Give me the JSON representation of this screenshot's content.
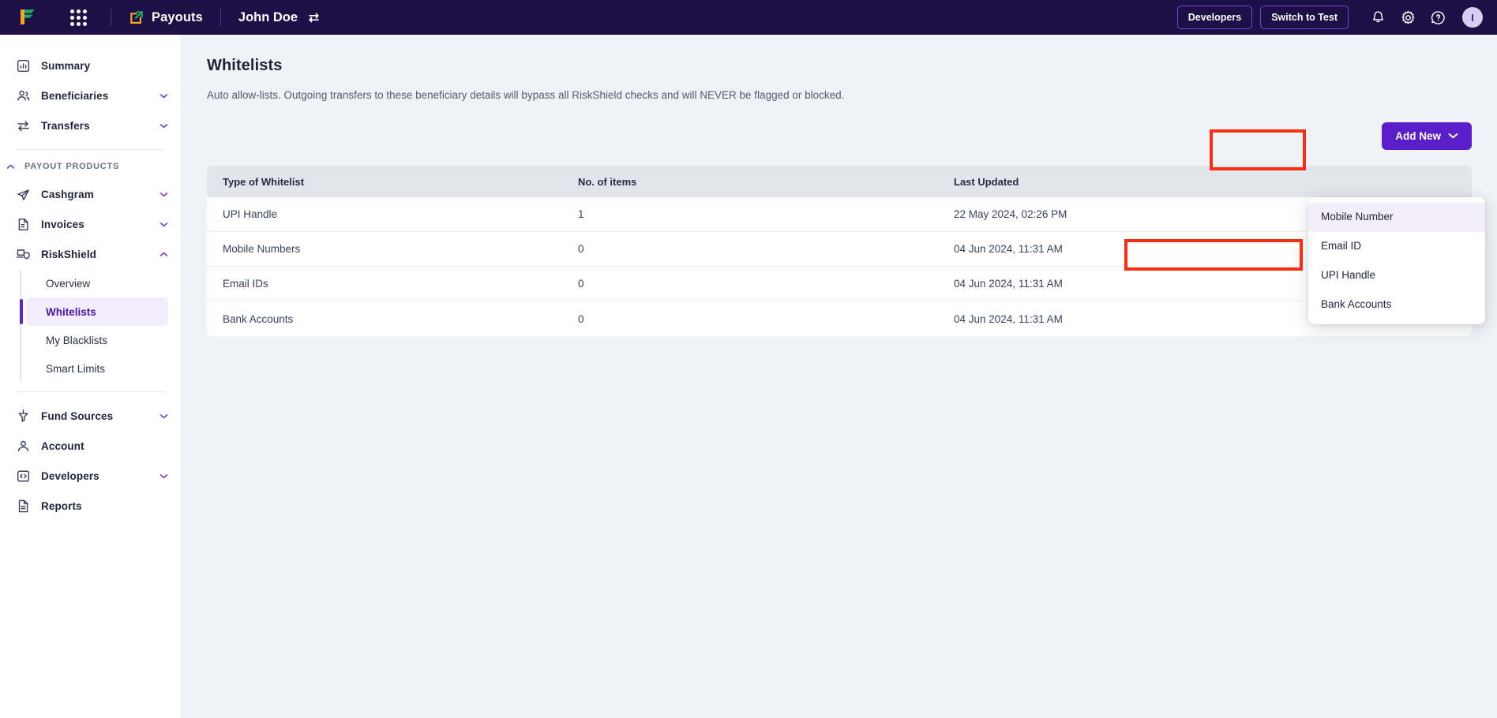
{
  "topbar": {
    "logo_name": "cashfree-logo",
    "apps_grid_name": "app-switcher-grid",
    "product_label": "Payouts",
    "account_name": "John Doe",
    "switch_account_icon": "swap-icon",
    "developers_label": "Developers",
    "switch_to_test_label": "Switch to Test",
    "notification_icon": "bell-icon",
    "settings_icon": "gear-icon",
    "help_icon": "help-circle-icon",
    "avatar_initial": "I"
  },
  "sidebar": {
    "top_items": [
      {
        "label": "Summary",
        "icon": "chart-bar-icon",
        "chevron": false
      },
      {
        "label": "Beneficiaries",
        "icon": "users-icon",
        "chevron": true
      },
      {
        "label": "Transfers",
        "icon": "transfer-icon",
        "chevron": true
      }
    ],
    "section_label": "PAYOUT PRODUCTS",
    "product_items": [
      {
        "label": "Cashgram",
        "icon": "send-icon",
        "chevron": true,
        "expanded": false
      },
      {
        "label": "Invoices",
        "icon": "invoice-icon",
        "chevron": true,
        "expanded": false
      },
      {
        "label": "RiskShield",
        "icon": "riskshield-icon",
        "chevron": true,
        "expanded": true
      }
    ],
    "riskshield_subitems": [
      {
        "label": "Overview",
        "active": false
      },
      {
        "label": "Whitelists",
        "active": true
      },
      {
        "label": "My Blacklists",
        "active": false
      },
      {
        "label": "Smart Limits",
        "active": false
      }
    ],
    "bottom_items": [
      {
        "label": "Fund Sources",
        "icon": "funnel-icon",
        "chevron": true
      },
      {
        "label": "Account",
        "icon": "person-icon",
        "chevron": false
      },
      {
        "label": "Developers",
        "icon": "code-icon",
        "chevron": true
      },
      {
        "label": "Reports",
        "icon": "document-icon",
        "chevron": false
      }
    ]
  },
  "main": {
    "title": "Whitelists",
    "description": "Auto allow-lists. Outgoing transfers to these beneficiary details will bypass all RiskShield checks and will NEVER be flagged or blocked.",
    "add_new_label": "Add New",
    "dropdown_items": [
      {
        "label": "Mobile Number",
        "hover": true,
        "highlighted": false
      },
      {
        "label": "Email ID",
        "hover": false,
        "highlighted": false
      },
      {
        "label": "UPI Handle",
        "hover": false,
        "highlighted": true
      },
      {
        "label": "Bank Accounts",
        "hover": false,
        "highlighted": false
      }
    ],
    "table": {
      "headers": [
        "Type of Whitelist",
        "No. of items",
        "Last Updated"
      ],
      "rows": [
        {
          "type": "UPI Handle",
          "count": "1",
          "updated": "22 May 2024, 02:26 PM"
        },
        {
          "type": "Mobile Numbers",
          "count": "0",
          "updated": "04 Jun 2024, 11:31 AM"
        },
        {
          "type": "Email IDs",
          "count": "0",
          "updated": "04 Jun 2024, 11:31 AM"
        },
        {
          "type": "Bank Accounts",
          "count": "0",
          "updated": "04 Jun 2024, 11:31 AM"
        }
      ]
    }
  },
  "colors": {
    "topbar_bg": "#1d1046",
    "accent_purple": "#5b1fc9",
    "active_nav_bg": "#f3eefd",
    "annotation_red": "#f92e10",
    "content_bg": "#eff2f6",
    "table_header_bg": "#e2e5ec"
  }
}
